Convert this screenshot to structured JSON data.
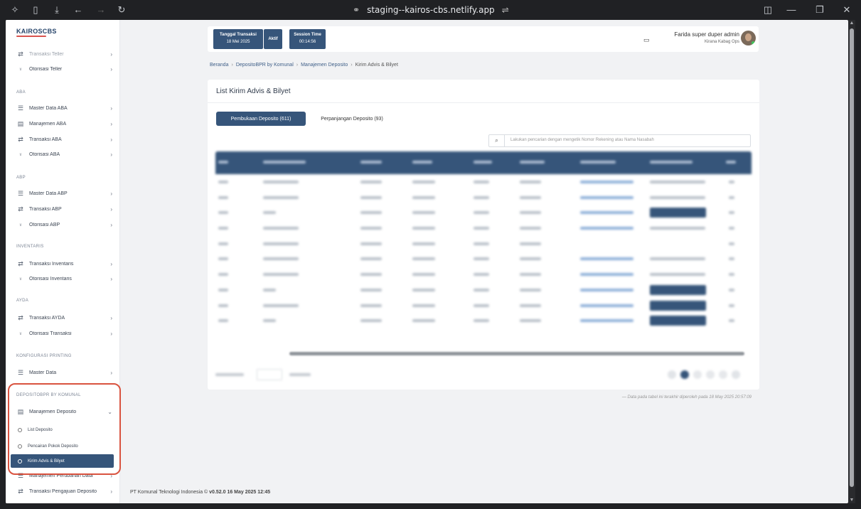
{
  "browser": {
    "url": "staging--kairos-cbs.netlify.app"
  },
  "sidebar": {
    "logo": "KAIROSCBS",
    "items": [
      {
        "label": "Transaksi Teller",
        "icon": "swap-icon"
      },
      {
        "label": "Otorisasi Teller",
        "icon": "user-check-icon"
      }
    ],
    "sections": [
      {
        "title": "ABA",
        "items": [
          {
            "label": "Master Data ABA",
            "icon": "server-icon"
          },
          {
            "label": "Manajemen ABA",
            "icon": "archive-icon"
          },
          {
            "label": "Transaksi ABA",
            "icon": "swap-icon"
          },
          {
            "label": "Otorisasi ABA",
            "icon": "user-check-icon"
          }
        ]
      },
      {
        "title": "ABP",
        "items": [
          {
            "label": "Master Data ABP",
            "icon": "server-icon"
          },
          {
            "label": "Transaksi ABP",
            "icon": "swap-icon"
          },
          {
            "label": "Otorisasi ABP",
            "icon": "user-check-icon"
          }
        ]
      },
      {
        "title": "INVENTARIS",
        "items": [
          {
            "label": "Transaksi Inventaris",
            "icon": "swap-icon"
          },
          {
            "label": "Otorisasi Inventaris",
            "icon": "user-check-icon"
          }
        ]
      },
      {
        "title": "AYDA",
        "items": [
          {
            "label": "Transaksi AYDA",
            "icon": "swap-icon"
          },
          {
            "label": "Otorisasi Transaksi",
            "icon": "user-check-icon"
          }
        ]
      },
      {
        "title": "KONFIGURASI PRINTING",
        "items": [
          {
            "label": "Master Data",
            "icon": "server-icon"
          }
        ]
      },
      {
        "title": "DEPOSITOBPR BY KOMUNAL",
        "items": [
          {
            "label": "Manajemen Deposito",
            "icon": "archive-icon"
          }
        ]
      }
    ],
    "sub_items": [
      {
        "label": "List Deposito"
      },
      {
        "label": "Pencairan Pokok Deposito"
      },
      {
        "label": "Kirim Advis & Bilyet"
      }
    ],
    "bottom_items": [
      {
        "label": "Manajemen Perubahan Data"
      },
      {
        "label": "Transaksi Pengajuan Deposito"
      }
    ]
  },
  "header": {
    "tanggal_label": "Tanggal Transaksi",
    "tanggal_value": "18 Mei 2025",
    "status": "Aktif",
    "session_label": "Session Time",
    "session_value": "00:14:56",
    "user_name": "Farida super duper admin",
    "user_role": "Kirana Kabag Ops"
  },
  "breadcrumb": [
    "Beranda",
    "DepositoBPR by Komunal",
    "Manajemen Deposito",
    "Kirim Advis & Bilyet"
  ],
  "main": {
    "title": "List Kirim Advis & Bilyet",
    "tabs": [
      {
        "label": "Pembukaan Deposito (611)",
        "active": true
      },
      {
        "label": "Perpanjangan Deposito (93)",
        "active": false
      }
    ],
    "search_placeholder": "Lakukan pencarian dengan mengetik Nomor Rekening atau Nama Nasabah",
    "footnote": "— Data pada tabel ini terakhir diperoleh pada 18 May 2025 20:57:09"
  },
  "footer": {
    "company": "PT Komunal Teknologi Indonesia ©",
    "version": "v0.52.0 16 May 2025 12:45"
  },
  "colors": {
    "primary": "#36557a",
    "highlight": "#d9533f"
  }
}
